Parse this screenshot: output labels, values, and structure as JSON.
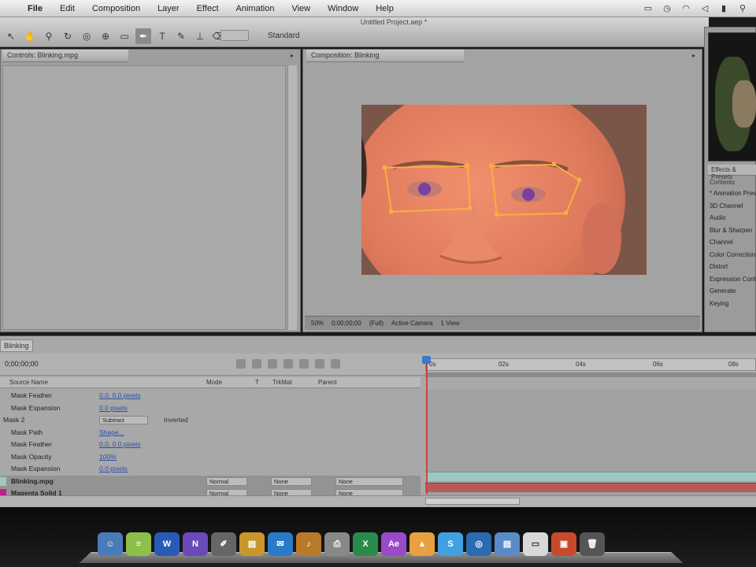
{
  "menubar": {
    "items": [
      "File",
      "Edit",
      "Composition",
      "Layer",
      "Effect",
      "Animation",
      "View",
      "Window",
      "Help"
    ]
  },
  "toolbar": {
    "project_title": "Untitled Project.aep *",
    "workspace_label": "Standard"
  },
  "left_panel": {
    "tab_label": "Controls: Blinking.mpg"
  },
  "comp_panel": {
    "tab_label": "Composition: Blinking",
    "viewer_toolbar": [
      "50%",
      "0;00;00;00",
      "(Full)",
      "Active Camera",
      "1 View"
    ]
  },
  "right_panel": {
    "tab_label": "Effects & Presets",
    "contents_label": "Contents",
    "items": [
      "* Animation Presets",
      "3D Channel",
      "Audio",
      "Blur & Sharpen",
      "Channel",
      "Color Correction",
      "Distort",
      "Expression Controls",
      "Generate",
      "Keying"
    ]
  },
  "timeline": {
    "tab_label": "Blinking",
    "timecode": "0;00;00;00",
    "ruler_ticks": [
      "0s",
      "02s",
      "04s",
      "06s",
      "08s"
    ],
    "columns": [
      "Source Name",
      "Mode",
      "T",
      "TrkMat",
      "Parent"
    ],
    "rows": [
      {
        "name": "Mask Feather",
        "value": "0.0, 0.0 pixels",
        "indent": 1
      },
      {
        "name": "Mask Expansion",
        "value": "0.0 pixels",
        "indent": 1
      },
      {
        "name": "Mask 2",
        "value": "Subtract",
        "value2": "Inverted",
        "indent": 0
      },
      {
        "name": "Mask Path",
        "value": "Shape...",
        "indent": 1
      },
      {
        "name": "Mask Feather",
        "value": "0.0, 0.0 pixels",
        "indent": 1
      },
      {
        "name": "Mask Opacity",
        "value": "100%",
        "indent": 1
      },
      {
        "name": "Mask Expansion",
        "value": "0.0 pixels",
        "indent": 1
      }
    ],
    "layers": [
      {
        "name": "Blinking.mpg",
        "mode": "Normal",
        "trkmat": "None",
        "parent": "None",
        "color": "#9ec8c2"
      },
      {
        "name": "Magenta Solid 1",
        "mode": "Normal",
        "trkmat": "None",
        "parent": "None",
        "color": "#c02090"
      }
    ]
  },
  "colors": {
    "mask_path": "#f5b040",
    "panel_bg": "#9e9e9e",
    "playhead": "#cc4444"
  }
}
